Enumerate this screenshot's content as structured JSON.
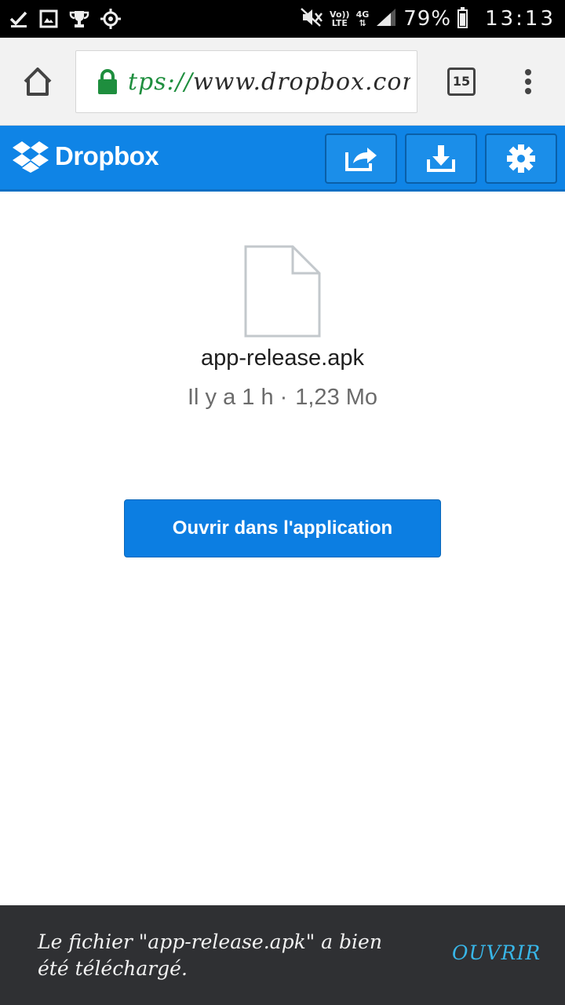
{
  "status_bar": {
    "network_top": "Vo))",
    "network_bottom": "LTE",
    "network_type": "4G",
    "battery_level": 0.79,
    "battery_text": "79%",
    "time": "13:13",
    "left_icons": [
      "check-icon",
      "image-icon",
      "trophy-icon",
      "crosshair-icon"
    ]
  },
  "browser": {
    "url_scheme": "tps://",
    "url_host": "www.dropbox.com/:",
    "tab_count": "15"
  },
  "header": {
    "logo_text": "Dropbox",
    "brand_color": "#0f84e6",
    "buttons": [
      "share-icon",
      "download-icon",
      "settings-icon"
    ]
  },
  "file": {
    "name": "app-release.apk",
    "time_ago": "Il y a 1 h",
    "separator": "·",
    "size": "1,23 Mo"
  },
  "open_button_label": "Ouvrir dans l'application",
  "snackbar": {
    "message": "Le fichier \"app-release.apk\" a bien été téléchargé.",
    "action": "OUVRIR"
  }
}
